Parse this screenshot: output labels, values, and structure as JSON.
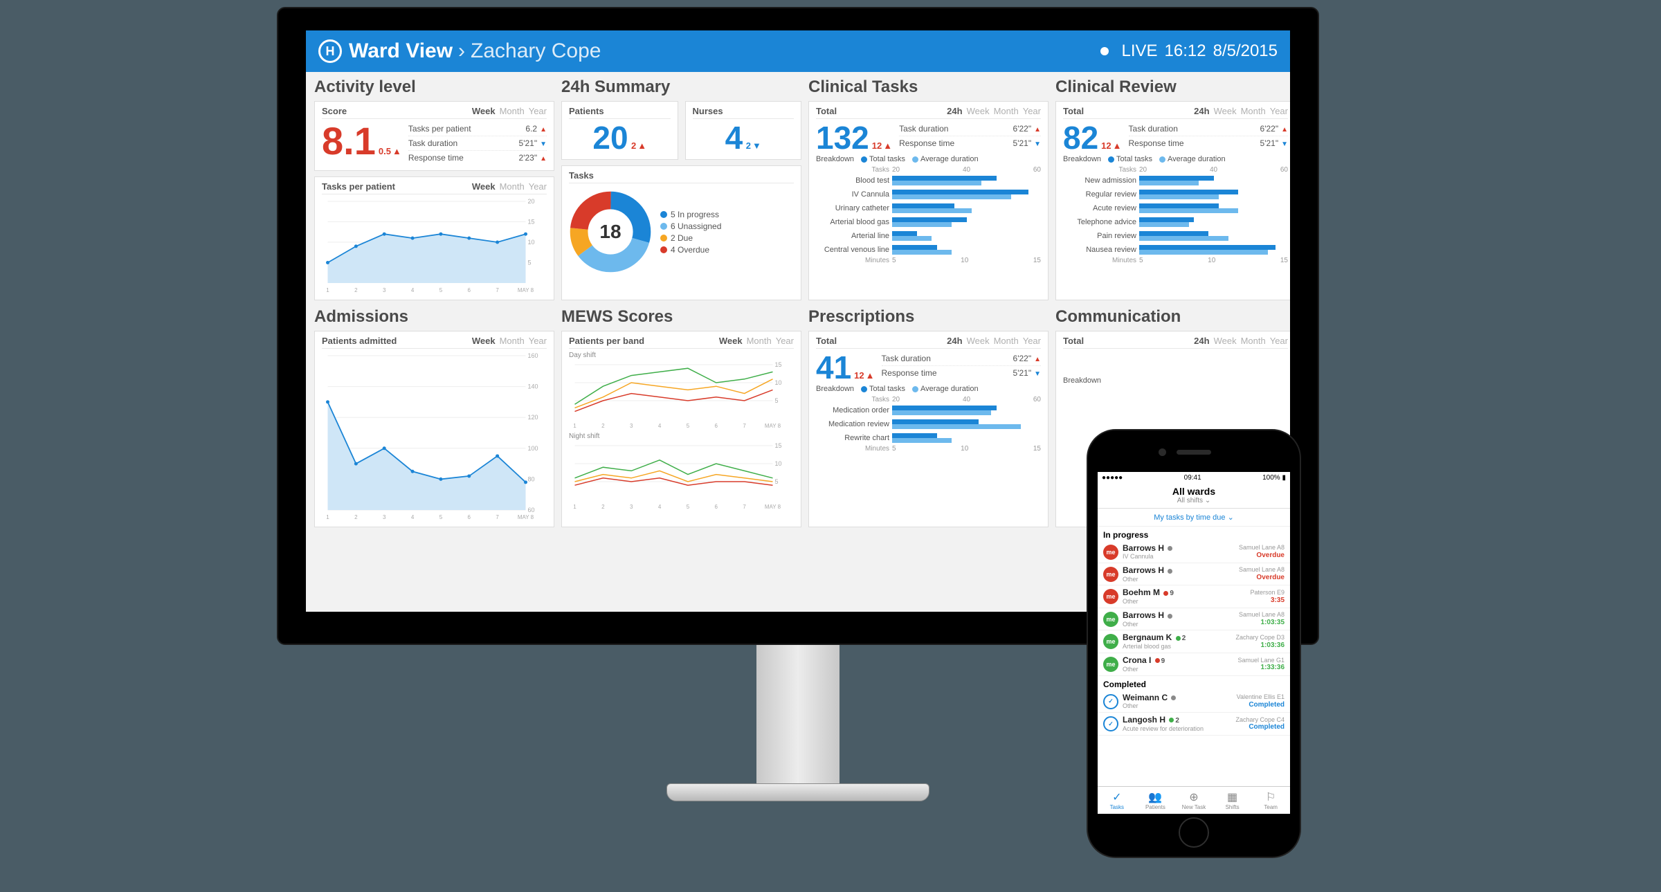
{
  "header": {
    "app": "Ward View",
    "crumb_sep": "›",
    "crumb": "Zachary Cope",
    "live": "LIVE",
    "time": "16:12",
    "date": "8/5/2015"
  },
  "timescale": {
    "week": "Week",
    "month": "Month",
    "year": "Year",
    "h24": "24h"
  },
  "activity": {
    "title": "Activity level",
    "score_label": "Score",
    "score": "8.1",
    "score_delta": "0.5",
    "stats": [
      {
        "label": "Tasks per patient",
        "value": "6.2",
        "dir": "up"
      },
      {
        "label": "Task duration",
        "value": "5'21\"",
        "dir": "down"
      },
      {
        "label": "Response time",
        "value": "2'23\"",
        "dir": "up"
      }
    ],
    "chart_label": "Tasks per patient"
  },
  "summary": {
    "title": "24h Summary",
    "patients_label": "Patients",
    "patients": "20",
    "patients_delta": "2",
    "nurses_label": "Nurses",
    "nurses": "4",
    "nurses_delta": "2",
    "tasks_label": "Tasks",
    "tasks_total": "18",
    "donut": [
      {
        "label": "5 In progress",
        "color": "#1b85d6"
      },
      {
        "label": "6 Unassigned",
        "color": "#6db9ed"
      },
      {
        "label": "2 Due",
        "color": "#f6a623"
      },
      {
        "label": "4 Overdue",
        "color": "#d83b2a"
      }
    ]
  },
  "clinical_tasks": {
    "title": "Clinical Tasks",
    "total_label": "Total",
    "total": "132",
    "total_delta": "12",
    "stats": [
      {
        "label": "Task duration",
        "value": "6'22\"",
        "dir": "up"
      },
      {
        "label": "Response time",
        "value": "5'21\"",
        "dir": "down"
      }
    ],
    "legend": {
      "breakdown": "Breakdown",
      "a": "Total tasks",
      "b": "Average duration"
    }
  },
  "clinical_review": {
    "title": "Clinical Review",
    "total_label": "Total",
    "total": "82",
    "total_delta": "12",
    "stats": [
      {
        "label": "Task duration",
        "value": "6'22\"",
        "dir": "up"
      },
      {
        "label": "Response time",
        "value": "5'21\"",
        "dir": "down"
      }
    ]
  },
  "admissions": {
    "title": "Admissions",
    "chart_label": "Patients admitted"
  },
  "mews": {
    "title": "MEWS Scores",
    "chart_label": "Patients per band",
    "day_label": "Day shift",
    "night_label": "Night shift"
  },
  "prescriptions": {
    "title": "Prescriptions",
    "total_label": "Total",
    "total": "41",
    "total_delta": "12",
    "stats": [
      {
        "label": "Task duration",
        "value": "6'22\"",
        "dir": "up"
      },
      {
        "label": "Response time",
        "value": "5'21\"",
        "dir": "down"
      }
    ]
  },
  "communication": {
    "title": "Communication",
    "total_label": "Total",
    "legend_breakdown": "Breakdown"
  },
  "axes": {
    "tasks_top": "Tasks",
    "minutes_bot": "Minutes",
    "xticks_week": [
      "1",
      "2",
      "3",
      "4",
      "5",
      "6",
      "7",
      "MAY 8"
    ],
    "yticks_tpp": [
      "5",
      "10",
      "15",
      "20"
    ],
    "yticks_adm": [
      "60",
      "80",
      "100",
      "120",
      "140",
      "160"
    ],
    "yticks_mews": [
      "5",
      "10",
      "15"
    ],
    "tasks_ticks": [
      "20",
      "40",
      "60"
    ],
    "min_ticks": [
      "5",
      "10",
      "15"
    ]
  },
  "chart_data": [
    {
      "type": "area",
      "name": "tasks_per_patient",
      "x": [
        1,
        2,
        3,
        4,
        5,
        6,
        7,
        8
      ],
      "values": [
        5,
        9,
        12,
        11,
        12,
        11,
        10,
        12
      ],
      "ylim": [
        0,
        20
      ]
    },
    {
      "type": "pie",
      "name": "tasks_donut",
      "slices": [
        {
          "label": "In progress",
          "value": 5
        },
        {
          "label": "Unassigned",
          "value": 6
        },
        {
          "label": "Due",
          "value": 2
        },
        {
          "label": "Overdue",
          "value": 4
        }
      ],
      "total": 18
    },
    {
      "type": "bar",
      "name": "clinical_tasks_breakdown",
      "categories": [
        "Blood test",
        "IV Cannula",
        "Urinary catheter",
        "Arterial blood gas",
        "Arterial line",
        "Central venous line"
      ],
      "series": [
        {
          "name": "Total tasks",
          "values": [
            42,
            55,
            25,
            30,
            10,
            18
          ]
        },
        {
          "name": "Average duration (min)",
          "values": [
            9,
            12,
            8,
            6,
            4,
            6
          ]
        }
      ],
      "xlim_tasks": [
        0,
        60
      ],
      "xlim_minutes": [
        0,
        15
      ]
    },
    {
      "type": "bar",
      "name": "clinical_review_breakdown",
      "categories": [
        "New admission",
        "Regular review",
        "Acute review",
        "Telephone advice",
        "Pain review",
        "Nausea review"
      ],
      "series": [
        {
          "name": "Total tasks",
          "values": [
            30,
            40,
            32,
            22,
            28,
            55
          ]
        },
        {
          "name": "Average duration (min)",
          "values": [
            6,
            8,
            10,
            5,
            9,
            13
          ]
        }
      ],
      "xlim_tasks": [
        0,
        60
      ],
      "xlim_minutes": [
        0,
        15
      ]
    },
    {
      "type": "area",
      "name": "patients_admitted",
      "x": [
        1,
        2,
        3,
        4,
        5,
        6,
        7,
        8
      ],
      "values": [
        130,
        90,
        100,
        85,
        80,
        82,
        95,
        78
      ],
      "ylim": [
        60,
        160
      ]
    },
    {
      "type": "line",
      "name": "mews_day",
      "x": [
        1,
        2,
        3,
        4,
        5,
        6,
        7,
        8
      ],
      "series": [
        {
          "name": "band1",
          "color": "#3fae49",
          "values": [
            4,
            9,
            12,
            13,
            14,
            10,
            11,
            13
          ]
        },
        {
          "name": "band2",
          "color": "#f6a623",
          "values": [
            3,
            6,
            10,
            9,
            8,
            9,
            7,
            11
          ]
        },
        {
          "name": "band3",
          "color": "#d83b2a",
          "values": [
            2,
            5,
            7,
            6,
            5,
            6,
            5,
            8
          ]
        }
      ],
      "ylim": [
        0,
        15
      ]
    },
    {
      "type": "line",
      "name": "mews_night",
      "x": [
        1,
        2,
        3,
        4,
        5,
        6,
        7,
        8
      ],
      "series": [
        {
          "name": "band1",
          "color": "#3fae49",
          "values": [
            6,
            9,
            8,
            11,
            7,
            10,
            8,
            6
          ]
        },
        {
          "name": "band2",
          "color": "#f6a623",
          "values": [
            5,
            7,
            6,
            8,
            5,
            7,
            6,
            5
          ]
        },
        {
          "name": "band3",
          "color": "#d83b2a",
          "values": [
            4,
            6,
            5,
            6,
            4,
            5,
            5,
            4
          ]
        }
      ],
      "ylim": [
        0,
        15
      ]
    },
    {
      "type": "bar",
      "name": "prescriptions_breakdown",
      "categories": [
        "Medication order",
        "Medication review",
        "Rewrite chart"
      ],
      "series": [
        {
          "name": "Total tasks",
          "values": [
            42,
            35,
            18
          ]
        },
        {
          "name": "Average duration (min)",
          "values": [
            10,
            13,
            6
          ]
        }
      ],
      "xlim_tasks": [
        0,
        60
      ],
      "xlim_minutes": [
        0,
        15
      ]
    }
  ],
  "phone": {
    "status": {
      "carrier": "●●●●●",
      "time": "09:41",
      "battery": "100%",
      "batt_icon": "▮"
    },
    "title": "All wards",
    "subtitle": "All shifts",
    "filter": "My tasks by time due",
    "groups": [
      {
        "label": "In progress",
        "items": [
          {
            "avatar": "me",
            "color": "red",
            "name": "Barrows H",
            "dot": "#8a8a8a",
            "sub": "IV Cannula",
            "loc": "Samuel Lane A8",
            "status": "Overdue",
            "cls": "red-t"
          },
          {
            "avatar": "me",
            "color": "red",
            "name": "Barrows H",
            "dot": "#8a8a8a",
            "sub": "Other",
            "loc": "Samuel Lane A8",
            "status": "Overdue",
            "cls": "red-t"
          },
          {
            "avatar": "me",
            "color": "red",
            "name": "Boehm M",
            "dot": "#d83b2a",
            "num": "9",
            "sub": "Other",
            "loc": "Paterson E9",
            "status": "3:35",
            "cls": "red-t"
          },
          {
            "avatar": "me",
            "color": "green",
            "name": "Barrows H",
            "dot": "#8a8a8a",
            "sub": "Other",
            "loc": "Samuel Lane A8",
            "status": "1:03:35",
            "cls": "green-t"
          },
          {
            "avatar": "me",
            "color": "green",
            "name": "Bergnaum K",
            "dot": "#3fae49",
            "num": "2",
            "sub": "Arterial blood gas",
            "loc": "Zachary Cope D3",
            "status": "1:03:36",
            "cls": "green-t"
          },
          {
            "avatar": "me",
            "color": "green",
            "name": "Crona I",
            "dot": "#d83b2a",
            "num": "9",
            "sub": "Other",
            "loc": "Samuel Lane G1",
            "status": "1:33:36",
            "cls": "green-t"
          }
        ]
      },
      {
        "label": "Completed",
        "items": [
          {
            "avatar": "✓",
            "color": "check",
            "name": "Weimann C",
            "dot": "#8a8a8a",
            "sub": "Other",
            "loc": "Valentine Ellis E1",
            "status": "Completed",
            "cls": "blue-t"
          },
          {
            "avatar": "✓",
            "color": "check",
            "name": "Langosh H",
            "dot": "#3fae49",
            "num": "2",
            "sub": "Acute review for deterioration",
            "loc": "Zachary Cope C4",
            "status": "Completed",
            "cls": "blue-t"
          }
        ]
      }
    ],
    "tabs": [
      {
        "label": "Tasks",
        "icon": "✓",
        "active": true
      },
      {
        "label": "Patients",
        "icon": "👥"
      },
      {
        "label": "New Task",
        "icon": "⊕"
      },
      {
        "label": "Shifts",
        "icon": "▦"
      },
      {
        "label": "Team",
        "icon": "⚐"
      }
    ]
  }
}
